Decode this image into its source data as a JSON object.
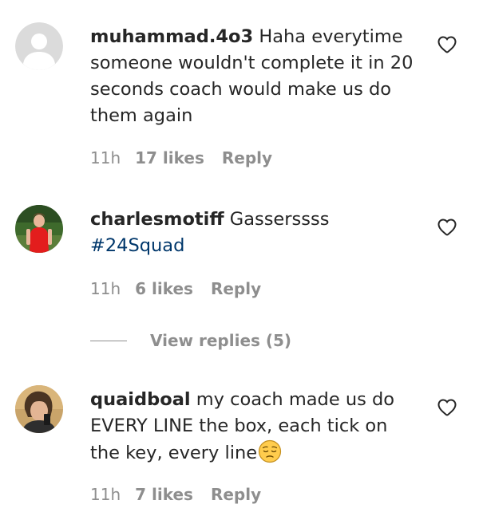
{
  "comments": [
    {
      "username": "muhammad.4o3",
      "text": "Haha everytime someone wouldn't complete it in 20 seconds coach would make us do them again",
      "time": "11h",
      "likes": "17 likes",
      "reply": "Reply",
      "avatar_icon": "default-avatar-icon"
    },
    {
      "username": "charlesmotiff",
      "text": "Gasserssss",
      "hashtag": "#24Squad",
      "time": "11h",
      "likes": "6 likes",
      "reply": "Reply",
      "avatar_icon": "user-photo-avatar"
    },
    {
      "username": "quaidboal",
      "text": "my coach made us do EVERY LINE the box, each tick on the key, every line",
      "emoji": "pensive-face-emoji",
      "time": "11h",
      "likes": "7 likes",
      "reply": "Reply",
      "avatar_icon": "user-photo-avatar"
    }
  ],
  "view_replies": {
    "label": "View replies (5)"
  },
  "colors": {
    "text": "#262626",
    "secondary": "#8e8e8e",
    "hashtag": "#00376b"
  }
}
